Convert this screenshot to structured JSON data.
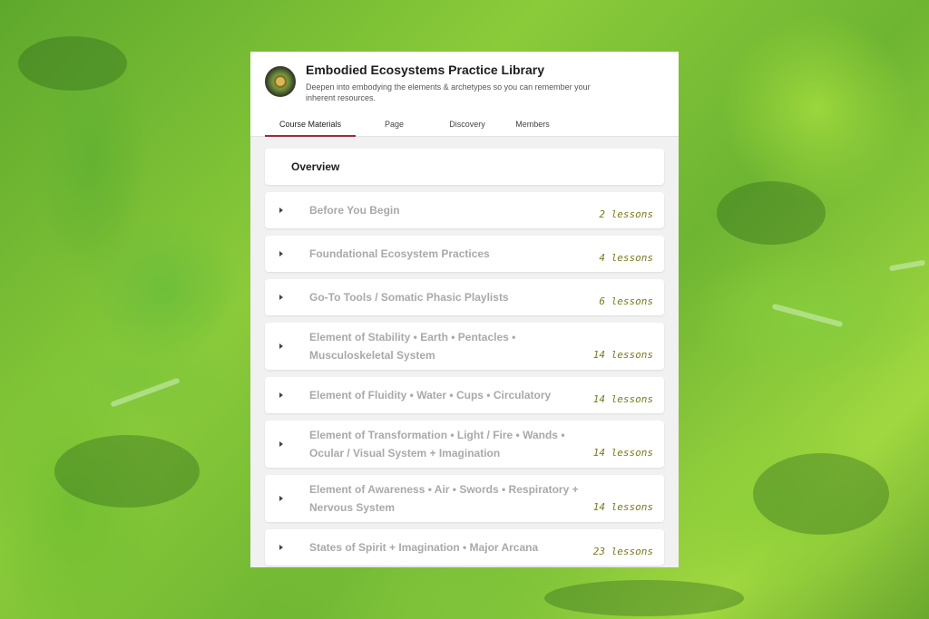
{
  "app": {
    "title": "Embodied Ecosystems Practice Library",
    "subtitle": "Deepen into embodying the elements & archetypes so you can remember your inherent resources."
  },
  "tabs": [
    {
      "label": "Course Materials",
      "active": true
    },
    {
      "label": "Page",
      "active": false
    },
    {
      "label": "Discovery",
      "active": false
    },
    {
      "label": "Members",
      "active": false
    }
  ],
  "overview": {
    "label": "Overview"
  },
  "sections": [
    {
      "title": "Before You Begin",
      "lessons": "2 lessons"
    },
    {
      "title": "Foundational Ecosystem Practices",
      "lessons": "4 lessons"
    },
    {
      "title": "Go-To Tools / Somatic Phasic Playlists",
      "lessons": "6 lessons"
    },
    {
      "title": "Element of Stability • Earth • Pentacles • Musculoskeletal System",
      "lessons": "14 lessons"
    },
    {
      "title": "Element of Fluidity • Water • Cups • Circulatory",
      "lessons": "14 lessons"
    },
    {
      "title": "Element of Transformation • Light / Fire • Wands • Ocular / Visual System + Imagination",
      "lessons": "14 lessons"
    },
    {
      "title": "Element of Awareness • Air • Swords • Respiratory + Nervous System",
      "lessons": "14 lessons"
    },
    {
      "title": "States of Spirit + Imagination • Major Arcana",
      "lessons": "23 lessons"
    }
  ],
  "colors": {
    "accent": "#9b2a44",
    "lesson_count": "#7c7a1c",
    "section_title": "#a9a9a9"
  },
  "icons": {
    "logo": "community-logo-emblem",
    "caret": "caret-right-icon"
  }
}
